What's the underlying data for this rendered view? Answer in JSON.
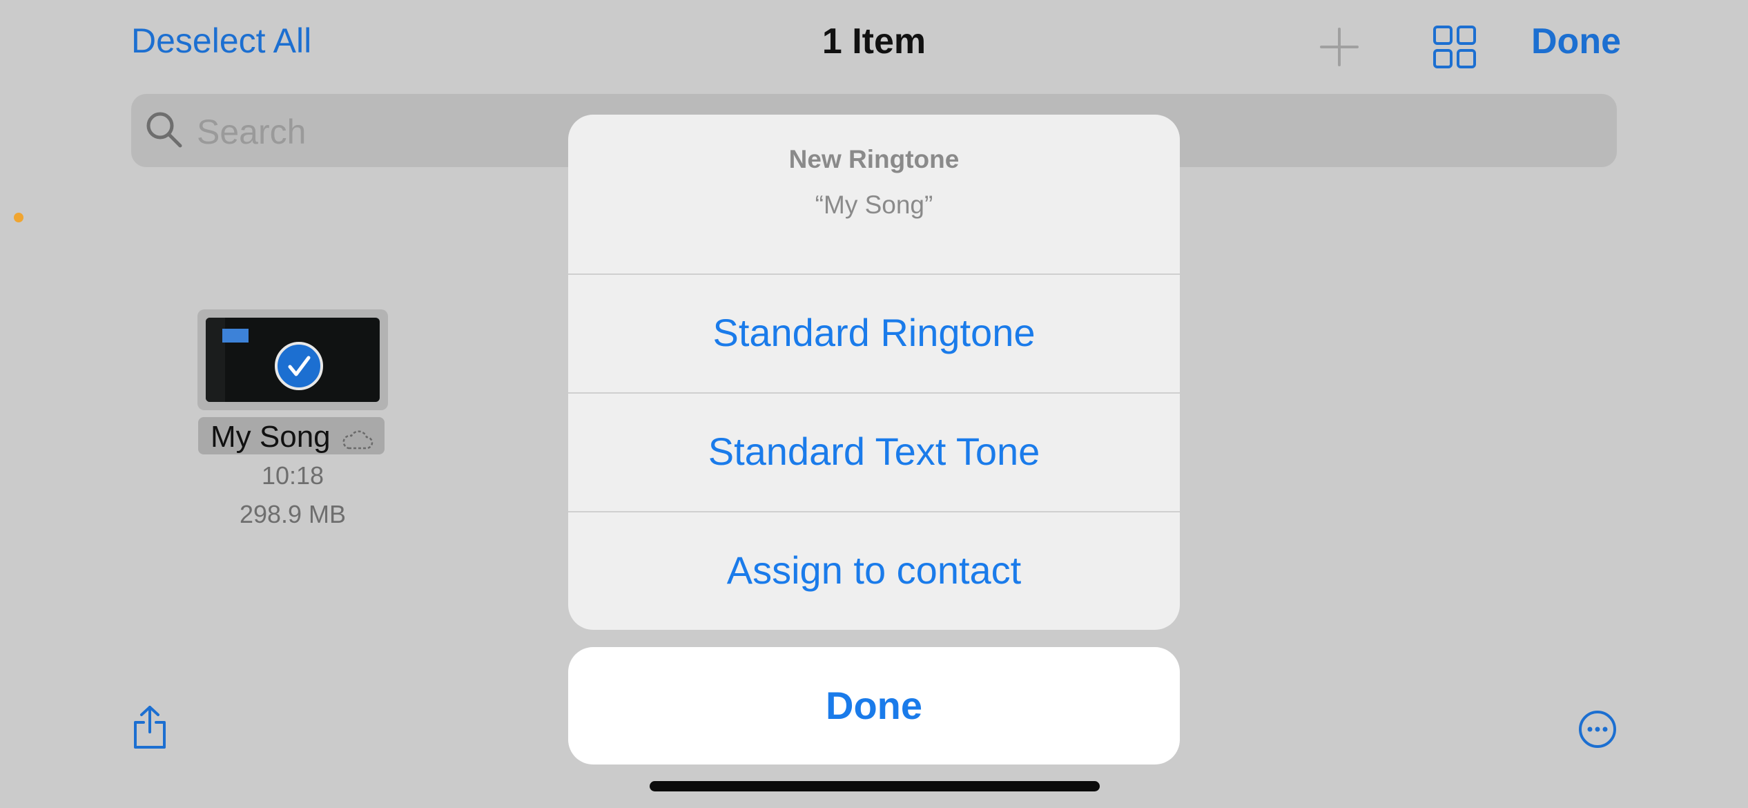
{
  "topbar": {
    "deselect_label": "Deselect All",
    "title": "1 Item",
    "add_icon": "plus-icon",
    "view_icon": "grid-icon",
    "done_label": "Done"
  },
  "search": {
    "placeholder": "Search",
    "icon": "magnifier-icon"
  },
  "file": {
    "name": "My Song",
    "time": "10:18",
    "size": "298.9 MB",
    "selected": true,
    "status_icon": "cloud-icon"
  },
  "sheet": {
    "title": "New Ringtone",
    "subtitle": "“My Song”",
    "options": [
      "Standard Ringtone",
      "Standard Text Tone",
      "Assign to contact"
    ],
    "done_label": "Done"
  },
  "toolbar": {
    "share_icon": "share-icon",
    "more_icon": "ellipsis-circle-icon"
  },
  "colors": {
    "accent": "#1a7bea",
    "background": "#cbcbcb",
    "indicator_dot": "#f0a531"
  }
}
